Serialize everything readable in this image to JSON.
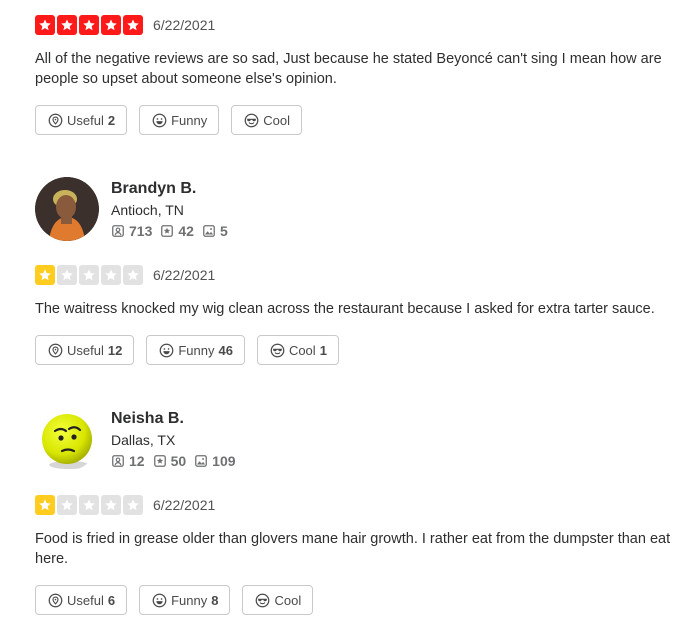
{
  "colors": {
    "star_red": "#ff1a1a",
    "star_yellow": "#ffcc1f",
    "star_empty": "#e2e2e2"
  },
  "reviews": [
    {
      "rating": 5,
      "date": "6/22/2021",
      "text": "All of the negative reviews are so sad, Just because he stated Beyoncé can't sing  I mean how are people so upset about someone else's opinion.",
      "useful_label": "Useful",
      "useful_count": "2",
      "funny_label": "Funny",
      "funny_count": "",
      "cool_label": "Cool",
      "cool_count": ""
    },
    {
      "user": {
        "name": "Brandyn B.",
        "location": "Antioch, TN",
        "friends": "713",
        "reviews": "42",
        "photos": "5"
      },
      "rating": 1,
      "date": "6/22/2021",
      "text": "The waitress knocked my wig clean across the restaurant because I asked for extra tarter sauce.",
      "useful_label": "Useful",
      "useful_count": "12",
      "funny_label": "Funny",
      "funny_count": "46",
      "cool_label": "Cool",
      "cool_count": "1"
    },
    {
      "user": {
        "name": "Neisha B.",
        "location": "Dallas, TX",
        "friends": "12",
        "reviews": "50",
        "photos": "109"
      },
      "rating": 1,
      "date": "6/22/2021",
      "text": "Food is fried in grease older than glovers mane hair growth. I rather eat from the dumpster than eat here.",
      "useful_label": "Useful",
      "useful_count": "6",
      "funny_label": "Funny",
      "funny_count": "8",
      "cool_label": "Cool",
      "cool_count": ""
    }
  ]
}
